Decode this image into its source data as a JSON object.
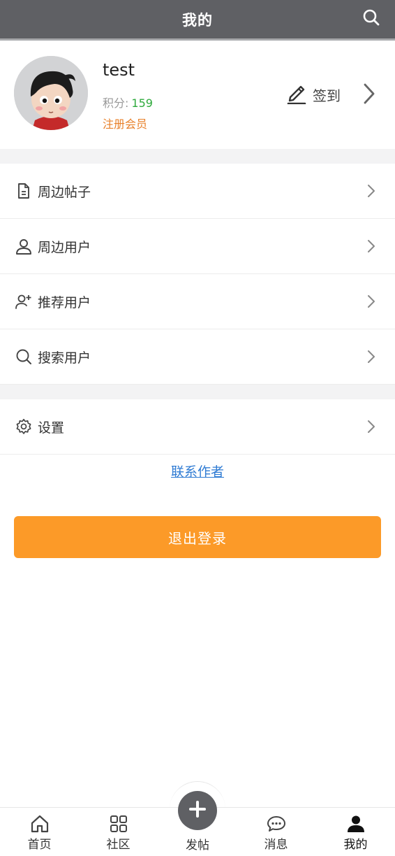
{
  "header": {
    "title": "我的",
    "search_icon": "search-icon"
  },
  "profile": {
    "username": "test",
    "points_label": "积分:",
    "points_value": "159",
    "member_level": "注册会员",
    "checkin_label": "签到",
    "checkin_icon": "pencil-icon"
  },
  "menu": {
    "items": [
      {
        "label": "周边帖子",
        "icon": "document-icon"
      },
      {
        "label": "周边用户",
        "icon": "user-icon"
      },
      {
        "label": "推荐用户",
        "icon": "user-plus-icon"
      },
      {
        "label": "搜索用户",
        "icon": "search-icon"
      },
      {
        "label": "设置",
        "icon": "gear-icon"
      }
    ]
  },
  "contact_link": "联系作者",
  "logout_label": "退出登录",
  "bottom_nav": {
    "items": [
      {
        "label": "首页",
        "icon": "home-icon"
      },
      {
        "label": "社区",
        "icon": "grid-icon"
      },
      {
        "label": "发帖",
        "icon": "plus-icon"
      },
      {
        "label": "消息",
        "icon": "message-icon"
      },
      {
        "label": "我的",
        "icon": "user-icon",
        "active": true
      }
    ]
  },
  "colors": {
    "header_bg": "#5f6064",
    "points_green": "#2eaa3c",
    "member_orange": "#e8802a",
    "link_blue": "#2f7bd3",
    "logout_orange": "#fc9a28"
  }
}
